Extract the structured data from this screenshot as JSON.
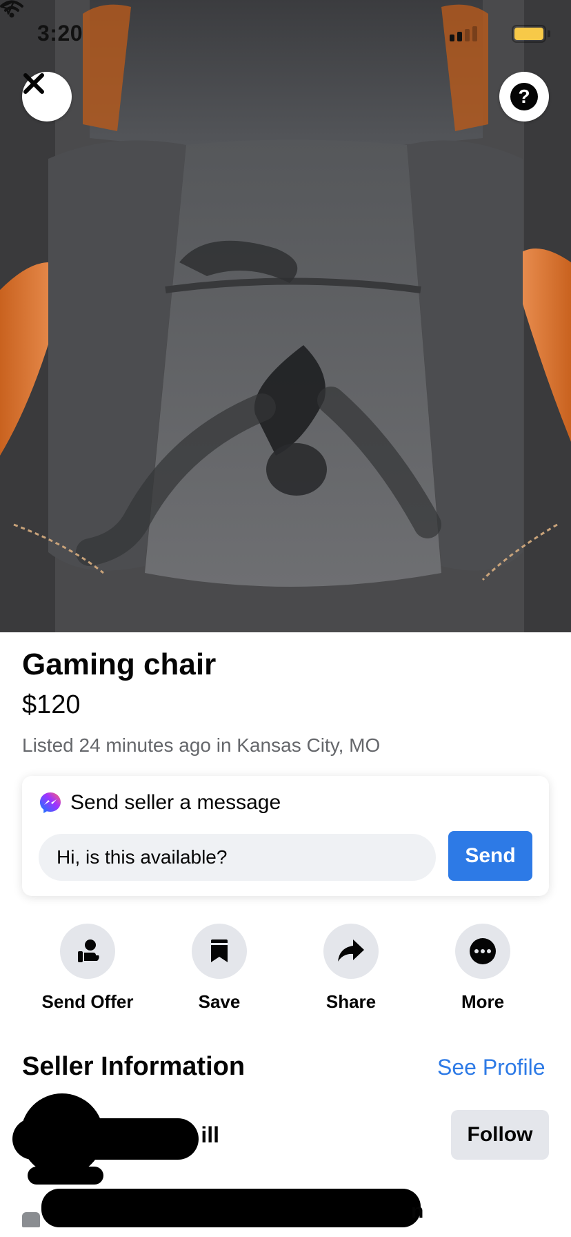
{
  "status_bar": {
    "time": "3:20"
  },
  "hero": {
    "alt": "Gaming chair photo",
    "close_icon": "close-icon",
    "help_icon": "help-icon",
    "help_glyph": "?"
  },
  "listing": {
    "title": "Gaming chair",
    "price": "$120",
    "meta": "Listed 24 minutes ago in Kansas City, MO"
  },
  "message": {
    "heading": "Send seller a message",
    "input_value": "Hi, is this available?",
    "send_label": "Send"
  },
  "actions": [
    {
      "label": "Send Offer",
      "icon": "send-offer-icon"
    },
    {
      "label": "Save",
      "icon": "bookmark-icon"
    },
    {
      "label": "Share",
      "icon": "share-icon"
    },
    {
      "label": "More",
      "icon": "more-icon"
    }
  ],
  "seller": {
    "heading": "Seller Information",
    "see_profile": "See Profile",
    "name_visible": "ill",
    "follow_label": "Follow",
    "sub_visible": "n"
  },
  "colors": {
    "accent": "#2d7ae6",
    "secondary_text": "#65676b",
    "button_gray": "#e4e6eb",
    "input_gray": "#eff1f4",
    "battery": "#f7c948"
  }
}
